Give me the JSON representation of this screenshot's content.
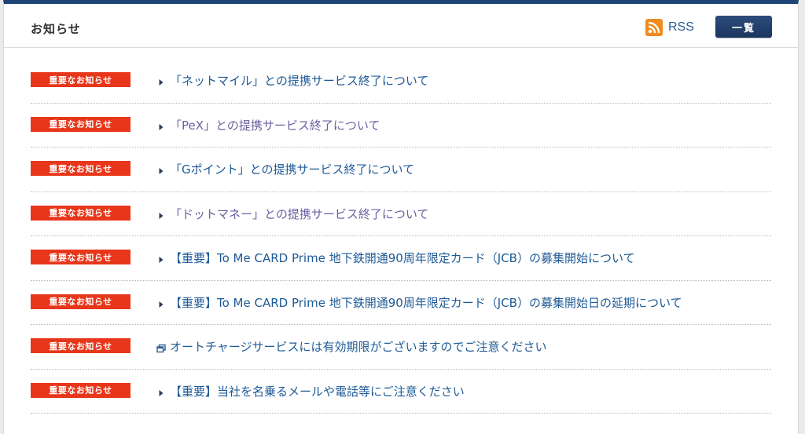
{
  "header": {
    "title": "お知らせ",
    "rss_label": "RSS",
    "list_button_label": "一覧"
  },
  "colors": {
    "accent_bar": "#1f4478",
    "badge": "#e8361a",
    "link": "#1d5a96",
    "visited_link": "#6b5fa0",
    "rss": "#f18b1f"
  },
  "news": [
    {
      "badge": "重要なお知らせ",
      "icon": "arrow-right-icon",
      "text": "「ネットマイル」との提携サービス終了について",
      "visited": false
    },
    {
      "badge": "重要なお知らせ",
      "icon": "arrow-right-icon",
      "text": "「PeX」との提携サービス終了について",
      "visited": true
    },
    {
      "badge": "重要なお知らせ",
      "icon": "arrow-right-icon",
      "text": "「Gポイント」との提携サービス終了について",
      "visited": false
    },
    {
      "badge": "重要なお知らせ",
      "icon": "arrow-right-icon",
      "text": "「ドットマネー」との提携サービス終了について",
      "visited": true
    },
    {
      "badge": "重要なお知らせ",
      "icon": "arrow-right-icon",
      "text": "【重要】To Me CARD Prime 地下鉄開通90周年限定カード（JCB）の募集開始について",
      "visited": false
    },
    {
      "badge": "重要なお知らせ",
      "icon": "arrow-right-icon",
      "text": "【重要】To Me CARD Prime 地下鉄開通90周年限定カード（JCB）の募集開始日の延期について",
      "visited": false
    },
    {
      "badge": "重要なお知らせ",
      "icon": "external-window-icon",
      "text": "オートチャージサービスには有効期限がございますのでご注意ください",
      "visited": false
    },
    {
      "badge": "重要なお知らせ",
      "icon": "arrow-right-icon",
      "text": "【重要】当社を名乗るメールや電話等にご注意ください",
      "visited": false
    }
  ]
}
